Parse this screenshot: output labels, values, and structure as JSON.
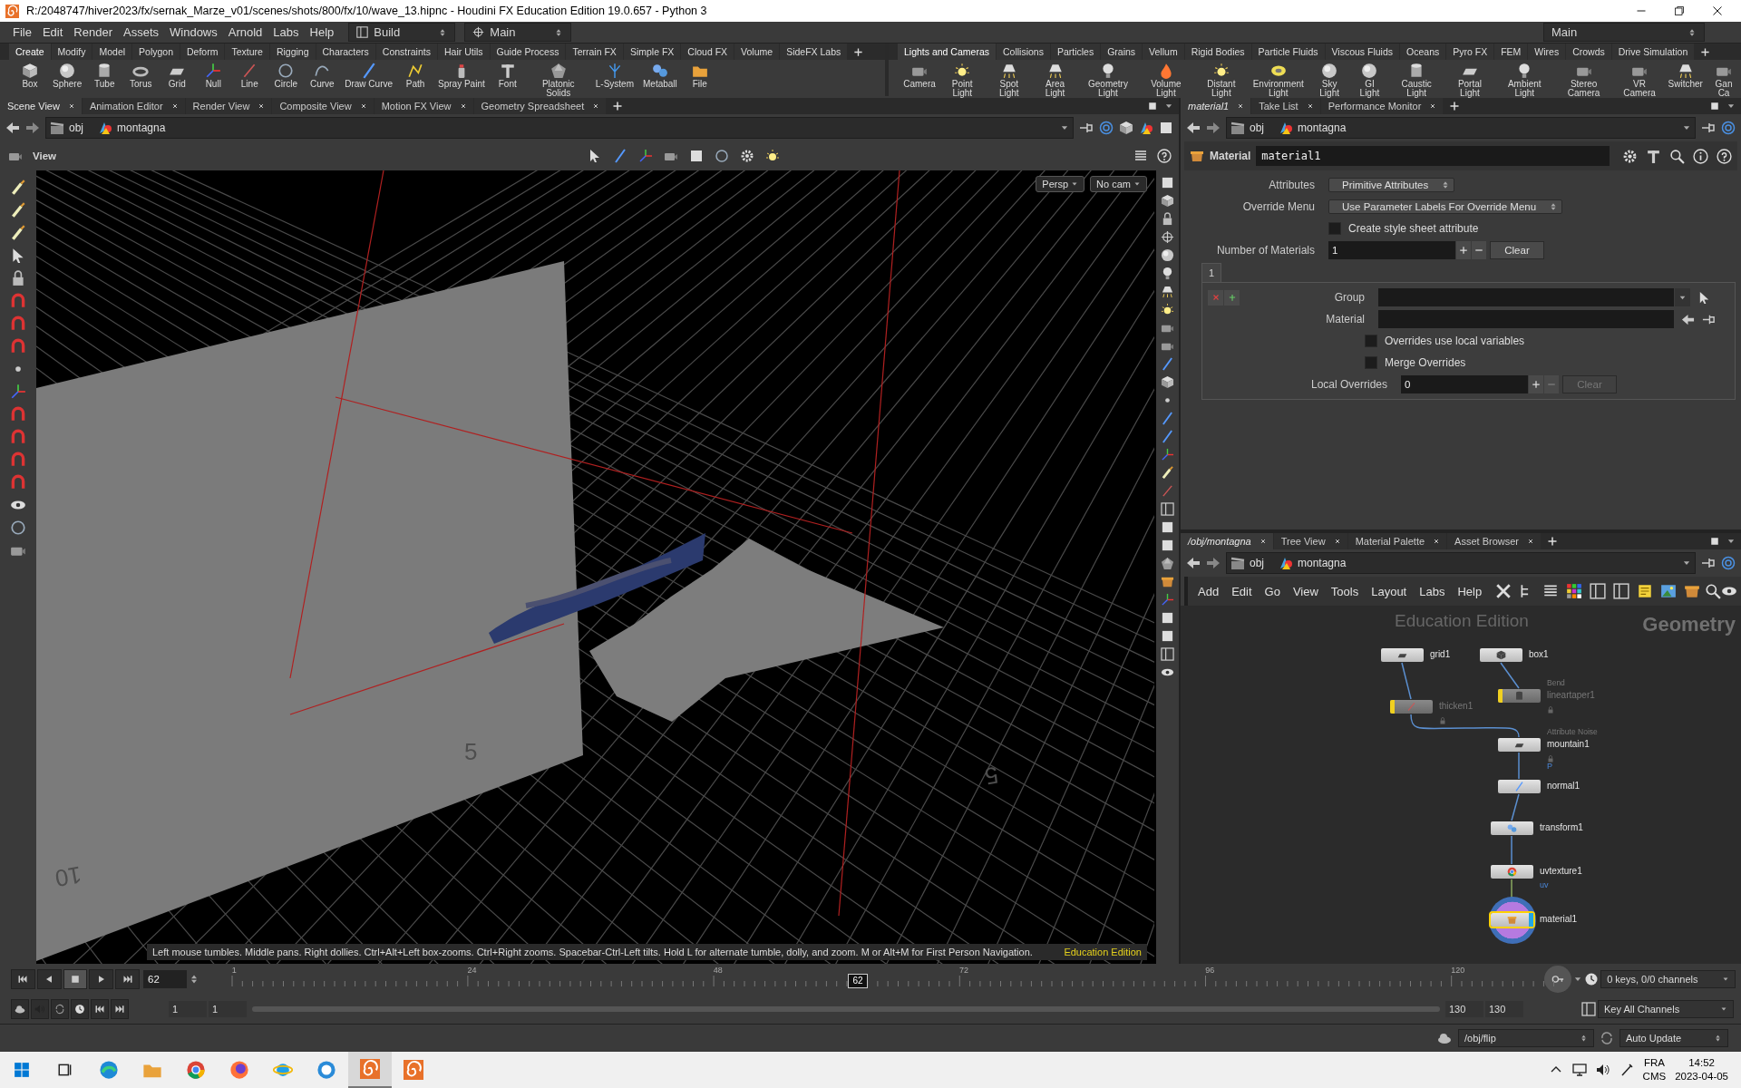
{
  "window": {
    "title": "R:/2048747/hiver2023/fx/sernak_Marze_v01/scenes/shots/800/fx/10/wave_13.hipnc - Houdini FX Education Edition 19.0.657 - Python 3"
  },
  "menu": [
    "File",
    "Edit",
    "Render",
    "Assets",
    "Windows",
    "Arnold",
    "Labs",
    "Help"
  ],
  "desktops": [
    "Build",
    "Main"
  ],
  "right_desktop": "Main",
  "shelves": [
    {
      "tabs": [
        {
          "label": "Create",
          "selected": true
        },
        {
          "label": "Modify",
          "selected": false
        },
        {
          "label": "Model",
          "selected": false
        },
        {
          "label": "Polygon",
          "selected": false
        },
        {
          "label": "Deform",
          "selected": false
        },
        {
          "label": "Texture",
          "selected": false
        },
        {
          "label": "Rigging",
          "selected": false
        },
        {
          "label": "Characters",
          "selected": false
        },
        {
          "label": "Constraints",
          "selected": false
        },
        {
          "label": "Hair Utils",
          "selected": false
        },
        {
          "label": "Guide Process",
          "selected": false
        },
        {
          "label": "Terrain FX",
          "selected": false
        },
        {
          "label": "Simple FX",
          "selected": false
        },
        {
          "label": "Cloud FX",
          "selected": false
        },
        {
          "label": "Volume",
          "selected": false
        },
        {
          "label": "SideFX Labs",
          "selected": false
        }
      ],
      "tools": [
        "Box",
        "Sphere",
        "Tube",
        "Torus",
        "Grid",
        "Null",
        "Line",
        "Circle",
        "Curve",
        "Draw Curve",
        "Path",
        "Spray Paint",
        "Font",
        "Platonic Solids",
        "L-System",
        "Metaball",
        "File"
      ]
    },
    {
      "tabs": [
        {
          "label": "Lights and Cameras",
          "selected": true
        },
        {
          "label": "Collisions",
          "selected": false
        },
        {
          "label": "Particles",
          "selected": false
        },
        {
          "label": "Grains",
          "selected": false
        },
        {
          "label": "Vellum",
          "selected": false
        },
        {
          "label": "Rigid Bodies",
          "selected": false
        },
        {
          "label": "Particle Fluids",
          "selected": false
        },
        {
          "label": "Viscous Fluids",
          "selected": false
        },
        {
          "label": "Oceans",
          "selected": false
        },
        {
          "label": "Pyro FX",
          "selected": false
        },
        {
          "label": "FEM",
          "selected": false
        },
        {
          "label": "Wires",
          "selected": false
        },
        {
          "label": "Crowds",
          "selected": false
        },
        {
          "label": "Drive Simulation",
          "selected": false
        }
      ],
      "tools": [
        "Camera",
        "Point Light",
        "Spot Light",
        "Area Light",
        "Geometry Light",
        "Volume Light",
        "Distant Light",
        "Environment Light",
        "Sky Light",
        "GI Light",
        "Caustic Light",
        "Portal Light",
        "Ambient Light",
        "Stereo Camera",
        "VR Camera",
        "Switcher",
        "Gan Ca"
      ]
    }
  ],
  "scene_pane": {
    "tabs": [
      {
        "label": "Scene View",
        "selected": true
      },
      {
        "label": "Animation Editor",
        "selected": false
      },
      {
        "label": "Render View",
        "selected": false
      },
      {
        "label": "Composite View",
        "selected": false
      },
      {
        "label": "Motion FX View",
        "selected": false
      },
      {
        "label": "Geometry Spreadsheet",
        "selected": false
      }
    ],
    "path": [
      "obj",
      "montagna"
    ],
    "view_label": "View",
    "view_menus": [
      "Persp",
      "No cam"
    ],
    "grid_labels": [
      "10",
      "5",
      "5"
    ],
    "hint": "Left mouse tumbles. Middle pans. Right dollies. Ctrl+Alt+Left box-zooms. Ctrl+Right zooms. Spacebar-Ctrl-Left tilts. Hold L for alternate tumble, dolly, and zoom.    M or Alt+M for First Person Navigation.",
    "edition": "Education Edition"
  },
  "parameter_pane": {
    "tabs": [
      {
        "label": "material1",
        "selected": true
      },
      {
        "label": "Take List",
        "selected": false
      },
      {
        "label": "Performance Monitor",
        "selected": false
      }
    ],
    "path": [
      "obj",
      "montagna"
    ],
    "node_type": "Material",
    "node_name": "material1",
    "rows": [
      {
        "kind": "menu",
        "label": "Attributes",
        "value": "Primitive Attributes"
      },
      {
        "kind": "menu",
        "label": "Override Menu",
        "value": "Use Parameter Labels For Override Menu"
      },
      {
        "kind": "toggle",
        "label": "Create style sheet attribute",
        "checked": false
      },
      {
        "kind": "count",
        "label": "Number of Materials",
        "value": "1",
        "clear": "Clear",
        "disabled": false
      }
    ],
    "multiparm": {
      "tab": "1",
      "rows": [
        {
          "kind": "menu_field",
          "label": "Group"
        },
        {
          "kind": "field",
          "label": "Material"
        },
        {
          "kind": "toggle",
          "label": "Overrides use local variables",
          "checked": false
        },
        {
          "kind": "toggle",
          "label": "Merge Overrides",
          "checked": false
        },
        {
          "kind": "count",
          "label": "Local Overrides",
          "value": "0",
          "clear": "Clear",
          "disabled": true
        }
      ]
    }
  },
  "network_pane": {
    "tabs": [
      {
        "label": "/obj/montagna",
        "selected": true
      },
      {
        "label": "Tree View",
        "selected": false
      },
      {
        "label": "Material Palette",
        "selected": false
      },
      {
        "label": "Asset Browser",
        "selected": false
      }
    ],
    "path": [
      "obj",
      "montagna"
    ],
    "menu": [
      "Add",
      "Edit",
      "Go",
      "View",
      "Tools",
      "Layout",
      "Labs",
      "Help"
    ],
    "watermark": "Education Edition",
    "context": "Geometry",
    "nodes": [
      {
        "name": "grid1",
        "bypassed": false,
        "display": false,
        "selected": false,
        "locked": false
      },
      {
        "name": "box1",
        "bypassed": false,
        "display": false,
        "selected": false,
        "locked": false
      },
      {
        "name": "thicken1",
        "bypassed": true,
        "display": false,
        "selected": false,
        "locked": true
      },
      {
        "name": "lineartaper1",
        "type": "Bend",
        "bypassed": true,
        "display": false,
        "selected": false,
        "locked": true
      },
      {
        "name": "mountain1",
        "type": "Attribute Noise",
        "attribute": "P",
        "bypassed": false,
        "display": false,
        "selected": false,
        "locked": true
      },
      {
        "name": "normal1",
        "bypassed": false,
        "display": false,
        "selected": false,
        "locked": false
      },
      {
        "name": "transform1",
        "bypassed": false,
        "display": false,
        "selected": false,
        "locked": false
      },
      {
        "name": "uvtexture1",
        "attribute": "uv",
        "bypassed": false,
        "display": false,
        "selected": false,
        "locked": false
      },
      {
        "name": "material1",
        "bypassed": false,
        "display": true,
        "selected": true,
        "locked": false
      }
    ]
  },
  "timeline": {
    "frame": "62",
    "playhead": {
      "label": "62",
      "level": 0.4729
    },
    "ticks": [
      "1",
      "24",
      "48",
      "72",
      "96",
      "120"
    ],
    "keys": "0 keys, 0/0 channels",
    "start": "1",
    "start_range": "1",
    "end_range": "130",
    "end": "130",
    "key_menu": "Key All Channels"
  },
  "status_bar": {
    "path": "/obj/flip",
    "update": "Auto Update"
  },
  "taskbar": {
    "language": "FRA",
    "layout": "CMS",
    "time": "14:52",
    "date": "2023-04-05"
  }
}
